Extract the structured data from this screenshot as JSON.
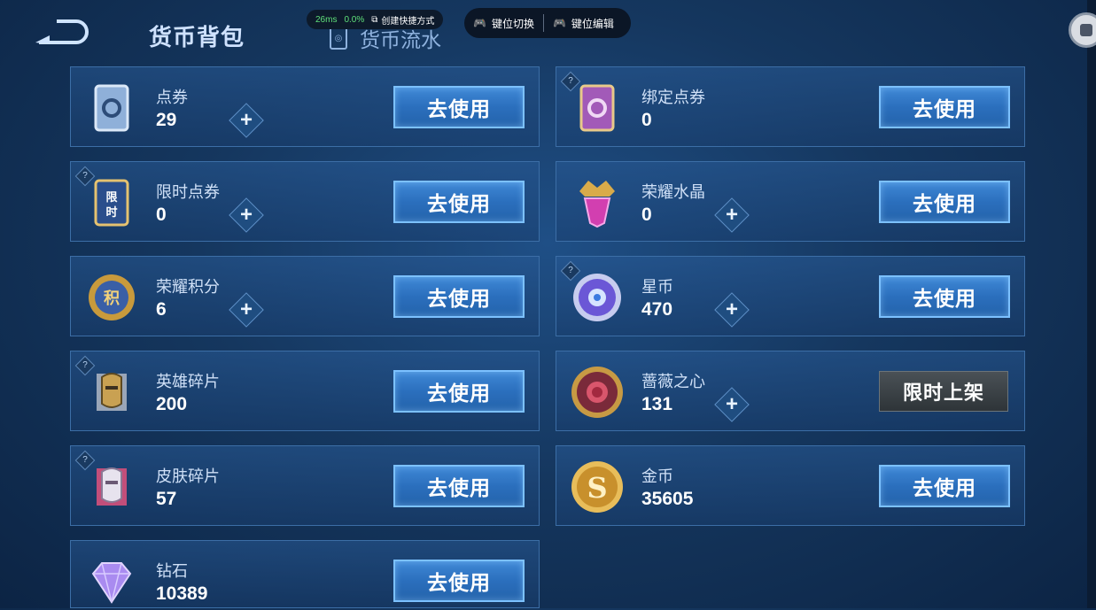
{
  "header": {
    "tab_backpack": "货币背包",
    "tab_flow": "货币流水",
    "perf_ms": "26ms",
    "perf_pct": "0.0%",
    "perf_shortcut": "创建快捷方式",
    "key_switch": "键位切换",
    "key_edit": "键位编辑"
  },
  "use_label": "去使用",
  "limited_label": "限时上架",
  "plus_label": "+",
  "help_label": "?",
  "currencies": [
    {
      "name": "点券",
      "value": "29",
      "icon": "voucher-icon",
      "help": false,
      "plus": true
    },
    {
      "name": "绑定点券",
      "value": "0",
      "icon": "bound-voucher-icon",
      "help": true,
      "plus": false
    },
    {
      "name": "限时点券",
      "value": "0",
      "icon": "limited-voucher-icon",
      "help": true,
      "plus": true
    },
    {
      "name": "荣耀水晶",
      "value": "0",
      "icon": "glory-crystal-icon",
      "help": false,
      "plus": true
    },
    {
      "name": "荣耀积分",
      "value": "6",
      "icon": "glory-points-icon",
      "help": false,
      "plus": true
    },
    {
      "name": "星币",
      "value": "470",
      "icon": "star-coin-icon",
      "help": true,
      "plus": true
    },
    {
      "name": "英雄碎片",
      "value": "200",
      "icon": "hero-fragment-icon",
      "help": true,
      "plus": false
    },
    {
      "name": "蔷薇之心",
      "value": "131",
      "icon": "rose-heart-icon",
      "help": false,
      "plus": true
    },
    {
      "name": "皮肤碎片",
      "value": "57",
      "icon": "skin-fragment-icon",
      "help": true,
      "plus": false
    },
    {
      "name": "金币",
      "value": "35605",
      "icon": "gold-coin-icon",
      "help": false,
      "plus": false
    },
    {
      "name": "钻石",
      "value": "10389",
      "icon": "diamond-icon",
      "help": false,
      "plus": false
    }
  ]
}
